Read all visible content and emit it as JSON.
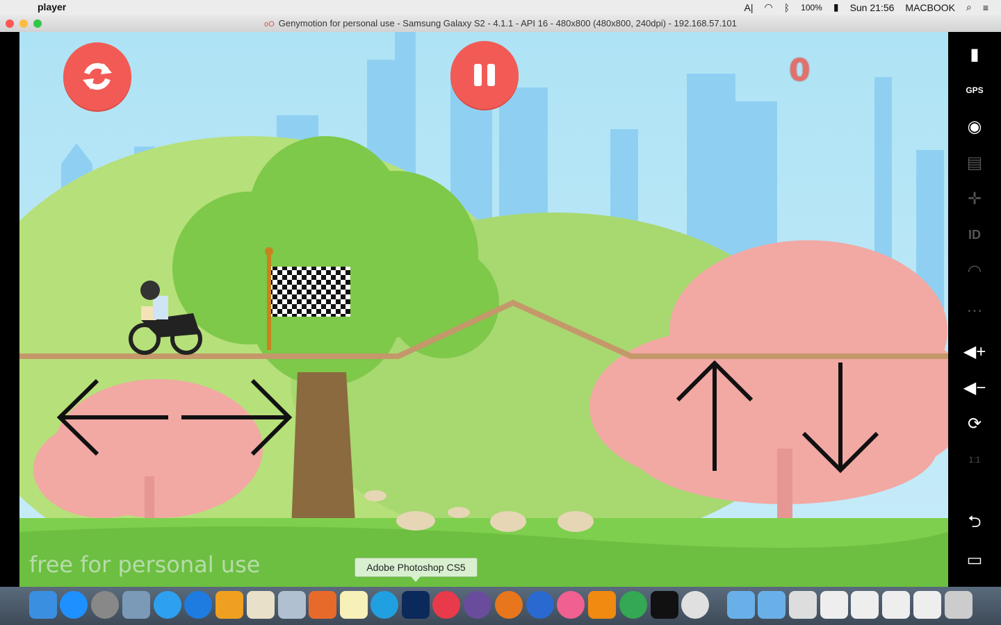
{
  "menubar": {
    "apple": "",
    "app_name": "player",
    "battery": "100%",
    "clock": "Sun 21:56",
    "host": "MACBOOK"
  },
  "window": {
    "title": "Genymotion for personal use - Samsung Galaxy S2 - 4.1.1 - API 16 - 480x800 (480x800, 240dpi) - 192.168.57.101"
  },
  "game": {
    "score": "0",
    "watermark": "free for personal use",
    "restart_icon": "restart-icon",
    "pause_icon": "pause-icon",
    "accent": "#f25b55"
  },
  "sidebar": {
    "items": [
      {
        "name": "battery-icon",
        "glyph": "▮"
      },
      {
        "name": "gps-icon",
        "glyph": "GPS"
      },
      {
        "name": "webcam-icon",
        "glyph": "◉"
      },
      {
        "name": "capture-icon",
        "glyph": "▤"
      },
      {
        "name": "dpad-icon",
        "glyph": "✛"
      },
      {
        "name": "id-icon",
        "glyph": "ID"
      },
      {
        "name": "rss-icon",
        "glyph": "◠"
      },
      {
        "name": "sms-icon",
        "glyph": "…"
      },
      {
        "name": "volume-up-icon",
        "glyph": "◀+"
      },
      {
        "name": "volume-down-icon",
        "glyph": "◀−"
      },
      {
        "name": "rotate-icon",
        "glyph": "⟳"
      },
      {
        "name": "scale-icon",
        "glyph": "1:1"
      },
      {
        "name": "back-icon",
        "glyph": "⮌"
      },
      {
        "name": "recent-apps-icon",
        "glyph": "▭"
      }
    ]
  },
  "dock": {
    "tooltip": "Adobe Photoshop CS5"
  }
}
